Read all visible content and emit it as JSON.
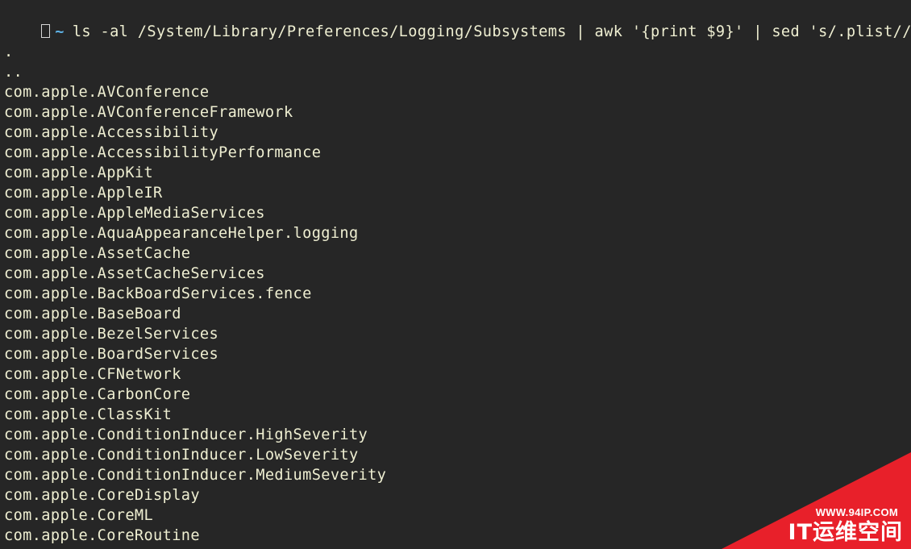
{
  "terminal": {
    "prompt_symbol": "~",
    "command": "ls -al /System/Library/Preferences/Logging/Subsystems | awk '{print $9}' | sed 's/.plist//g'",
    "output": [
      ".",
      "..",
      "com.apple.AVConference",
      "com.apple.AVConferenceFramework",
      "com.apple.Accessibility",
      "com.apple.AccessibilityPerformance",
      "com.apple.AppKit",
      "com.apple.AppleIR",
      "com.apple.AppleMediaServices",
      "com.apple.AquaAppearanceHelper.logging",
      "com.apple.AssetCache",
      "com.apple.AssetCacheServices",
      "com.apple.BackBoardServices.fence",
      "com.apple.BaseBoard",
      "com.apple.BezelServices",
      "com.apple.BoardServices",
      "com.apple.CFNetwork",
      "com.apple.CarbonCore",
      "com.apple.ClassKit",
      "com.apple.ConditionInducer.HighSeverity",
      "com.apple.ConditionInducer.LowSeverity",
      "com.apple.ConditionInducer.MediumSeverity",
      "com.apple.CoreDisplay",
      "com.apple.CoreML",
      "com.apple.CoreRoutine"
    ]
  },
  "watermark": {
    "url": "WWW.94IP.COM",
    "brand": "IT运维空间"
  },
  "colors": {
    "background": "#262626",
    "text": "#efefd2",
    "tilde": "#5fb4e8",
    "watermark_red": "#e8202a"
  }
}
